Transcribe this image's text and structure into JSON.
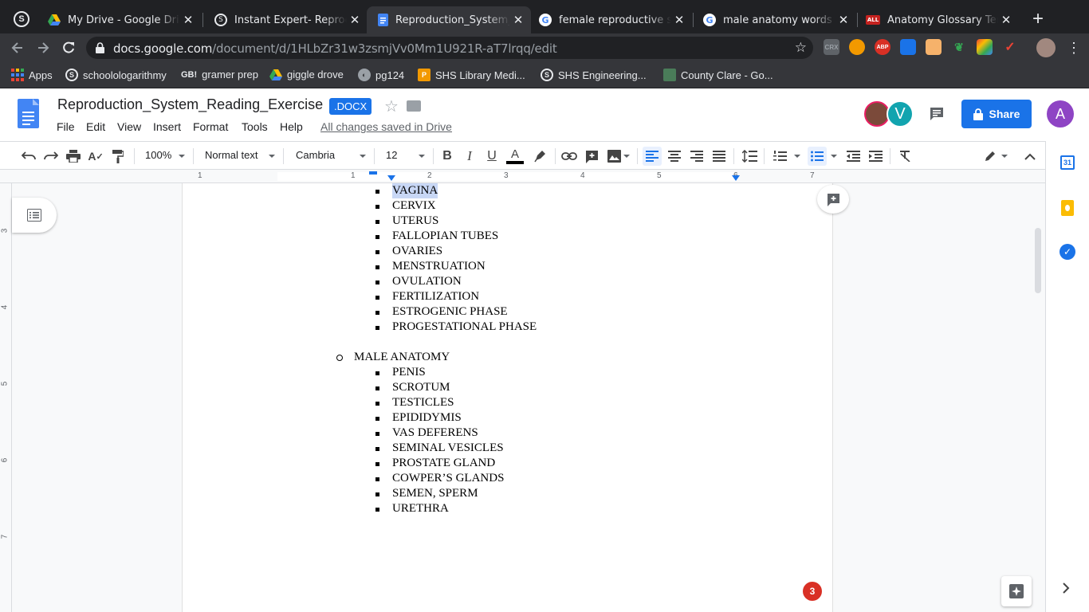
{
  "browser": {
    "tabs": [
      {
        "title": "My Drive - Google Drive",
        "icon": "google-drive-icon"
      },
      {
        "title": "Instant Expert- Reproduc",
        "icon": "schoology-icon"
      },
      {
        "title": "Reproduction_System_Re",
        "icon": "google-docs-icon",
        "active": true
      },
      {
        "title": "female reproductive syst",
        "icon": "google-icon"
      },
      {
        "title": "male anatomy words that",
        "icon": "google-icon"
      },
      {
        "title": "Anatomy Glossary Terms",
        "icon": "all-icon"
      }
    ],
    "tab_close": "✕",
    "new_tab": "+",
    "url_host": "docs.google.com",
    "url_path": "/document/d/1HLbZr31w3zsmjVv0Mm1U921R-aT7lrqq/edit",
    "extension_labels": [
      "CRX",
      "ABP"
    ],
    "bookmarks": [
      {
        "label": "Apps",
        "icon": "apps-grid-icon"
      },
      {
        "label": "schoolologarithmy",
        "icon": "schoology-icon"
      },
      {
        "label": "gramer prep",
        "icon": "gb-icon"
      },
      {
        "label": "giggle drove",
        "icon": "google-drive-icon"
      },
      {
        "label": "pg124",
        "icon": "globe-icon"
      },
      {
        "label": "SHS Library Medi...",
        "icon": "library-icon"
      },
      {
        "label": "SHS Engineering...",
        "icon": "schoology-icon"
      },
      {
        "label": "County Clare - Go...",
        "icon": "image-icon"
      }
    ]
  },
  "docs": {
    "title": "Reproduction_System_Reading_Exercise",
    "badge": ".DOCX",
    "menus": [
      "File",
      "Edit",
      "View",
      "Insert",
      "Format",
      "Tools",
      "Help"
    ],
    "saved_status": "All changes saved in Drive",
    "share_label": "Share",
    "avatar_v": "V",
    "avatar_a": "A",
    "colors": {
      "accent": "#1a73e8",
      "avatar_v": "#12a4af",
      "avatar_a": "#8e44c4",
      "highlight": "#c8d7f5"
    }
  },
  "format_toolbar": {
    "zoom": "100%",
    "style": "Normal text",
    "font": "Cambria",
    "size": "12",
    "bold": "B",
    "italic": "I",
    "underline": "U",
    "text_color": "A"
  },
  "ruler": {
    "numbers": [
      "1",
      "1",
      "2",
      "3",
      "4",
      "5",
      "6",
      "7"
    ],
    "vertical_numbers": [
      "3",
      "4",
      "5",
      "6",
      "7"
    ]
  },
  "document": {
    "female_items": [
      "VAGINA",
      "CERVIX",
      "UTERUS",
      "FALLOPIAN TUBES",
      "OVARIES",
      "MENSTRUATION",
      "OVULATION",
      "FERTILIZATION",
      "ESTROGENIC PHASE",
      "PROGESTATIONAL PHASE"
    ],
    "male_heading": "MALE ANATOMY",
    "male_items": [
      "PENIS",
      "SCROTUM",
      "TESTICLES",
      "EPIDIDYMIS",
      "VAS DEFERENS",
      "SEMINAL VESICLES",
      "PROSTATE GLAND",
      "COWPER’S GLANDS",
      "SEMEN, SPERM",
      "URETHRA"
    ]
  },
  "notifications_count": "3"
}
